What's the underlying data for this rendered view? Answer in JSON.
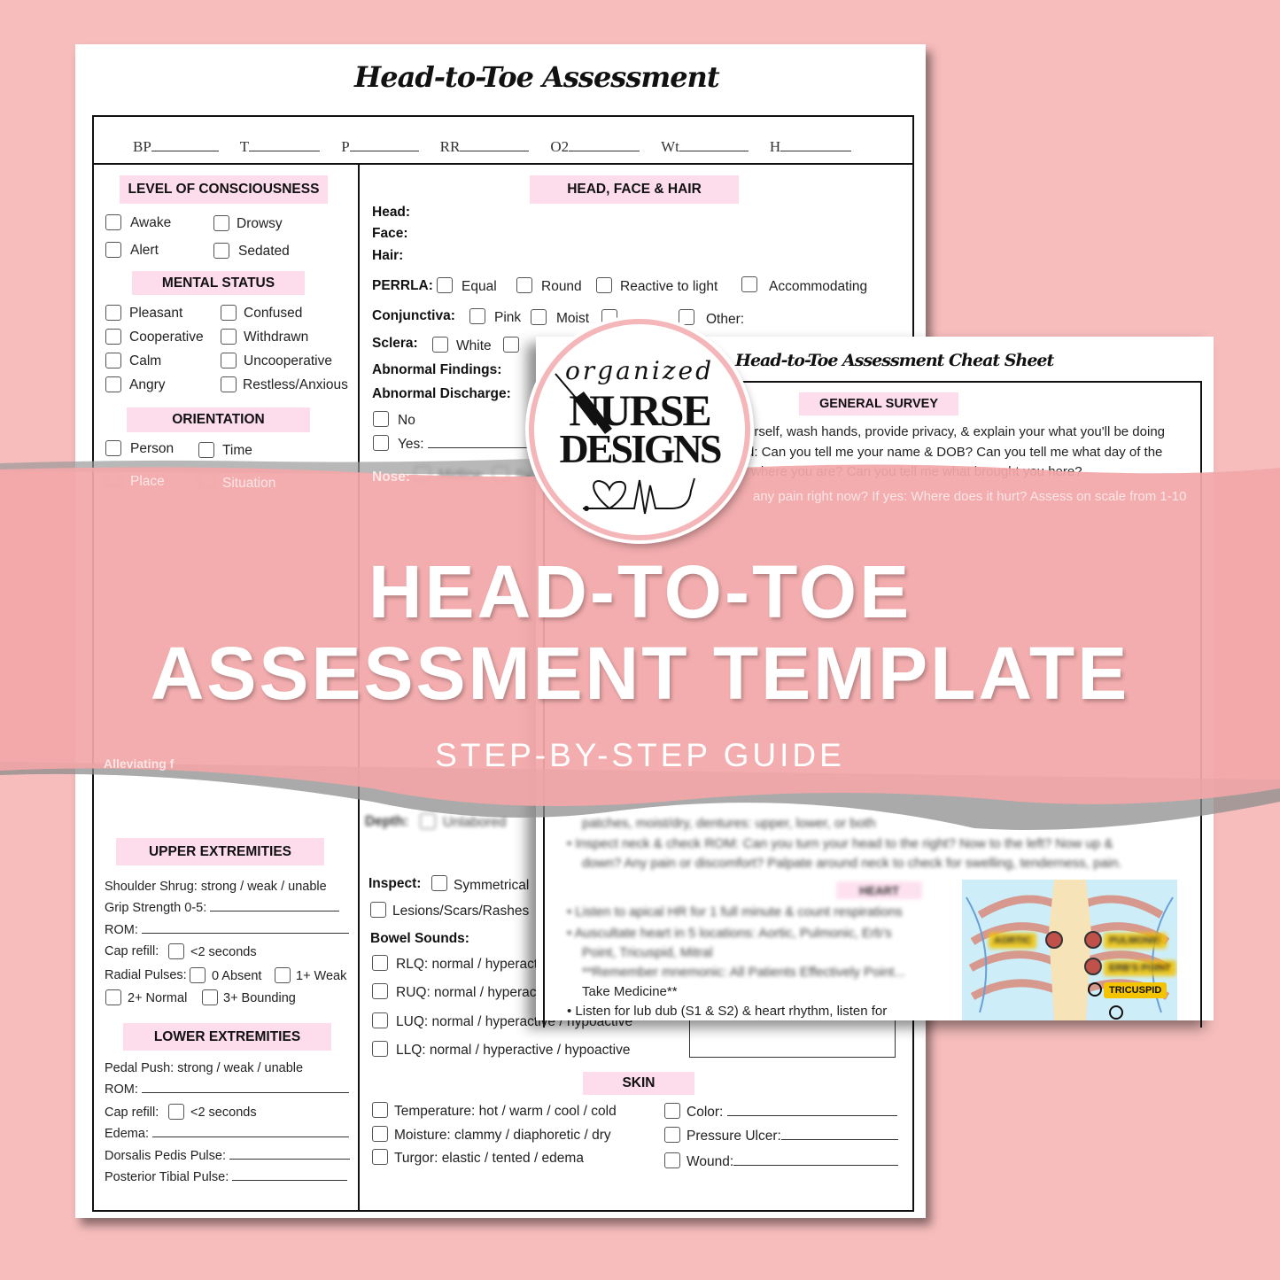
{
  "form": {
    "title": "Head-to-Toe Assessment",
    "vitals": [
      "BP",
      "T",
      "P",
      "RR",
      "O2",
      "Wt",
      "H"
    ],
    "loc": {
      "header": "LEVEL OF CONSCIOUSNESS",
      "options": [
        "Awake",
        "Drowsy",
        "Alert",
        "Sedated"
      ]
    },
    "mental": {
      "header": "MENTAL STATUS",
      "options": [
        "Pleasant",
        "Confused",
        "Cooperative",
        "Withdrawn",
        "Calm",
        "Uncooperative",
        "Angry",
        "Restless/Anxious"
      ]
    },
    "orientation": {
      "header": "ORIENTATION",
      "options": [
        "Person",
        "Time",
        "Place",
        "Situation"
      ]
    },
    "upper": {
      "header": "UPPER EXTREMITIES",
      "shoulder": "Shoulder Shrug: strong / weak / unable",
      "grip": "Grip Strength 0-5:",
      "rom": "ROM:",
      "cap": "Cap refill:",
      "cap_opt": "<2 seconds",
      "radial": "Radial Pulses:",
      "pulses": [
        "0 Absent",
        "1+ Weak",
        "2+ Normal",
        "3+ Bounding"
      ]
    },
    "lower": {
      "header": "LOWER EXTREMITIES",
      "pedal": "Pedal Push: strong / weak / unable",
      "rom": "ROM:",
      "cap": "Cap refill:",
      "cap_opt": "<2 seconds",
      "edema": "Edema:",
      "dorsalis": "Dorsalis Pedis Pulse:",
      "tibial": "Posterior Tibial Pulse:"
    },
    "alleviating": "Alleviating f",
    "hfh": {
      "header": "HEAD, FACE & HAIR",
      "head": "Head:",
      "face": "Face:",
      "hair": "Hair:",
      "perrla": "PERRLA:",
      "perrla_opts": [
        "Equal",
        "Round",
        "Reactive to light",
        "Accommodating"
      ],
      "conj": "Conjunctiva:",
      "conj_opts": [
        "Pink",
        "Moist",
        "Other:"
      ],
      "sclera": "Sclera:",
      "sclera_opts": [
        "White"
      ],
      "findings": "Abnormal Findings:",
      "discharge": "Abnormal Discharge:",
      "no": "No",
      "yes": "Yes:",
      "nose": "Nose:",
      "nose_opts": [
        "Midline",
        "Sy"
      ]
    },
    "depth": "Depth:",
    "depth_opt": "Unlabored",
    "inspect": "Inspect:",
    "inspect_opts": [
      "Symmetrical",
      "Lesions/Scars/Rashes"
    ],
    "bowel": {
      "header": "Bowel Sounds:",
      "items": [
        "RLQ: normal / hyperactive / hypoactive",
        "RUQ: normal / hyperactive / hypoactive",
        "LUQ: normal / hyperactive / hypoactive",
        "LLQ: normal / hyperactive / hypoactive"
      ]
    },
    "skin": {
      "header": "SKIN",
      "left": [
        "Temperature: hot / warm / cool / cold",
        "Moisture: clammy / diaphoretic / dry",
        "Turgor: elastic / tented / edema"
      ],
      "right": [
        "Color:",
        "Pressure Ulcer:",
        "Wound:"
      ]
    }
  },
  "cheat": {
    "title": "Head-to-Toe Assessment Cheat Sheet",
    "general_header": "GENERAL SURVEY",
    "lines": [
      "urself, wash hands, provide privacy, & explain your what you'll be doing",
      "d: Can you tell me your name & DOB? Can you tell me what day of the",
      "where you are?  Can you tell me what brought you here?",
      "any pain right now? If yes: Where does it hurt? Assess on scale from 1-10"
    ],
    "mouth": "patches, moist/dry, dentures: upper, lower, or both",
    "neck1": "Inspect neck & check ROM: Can you turn your head to the right? Now to the left? Now up &",
    "neck2": "down? Any pain or discomfort? Palpate around neck to check for swelling, tenderness, pain.",
    "heart_header": "HEART",
    "heart1": "Listen to apical HR for 1 full minute & count respirations",
    "heart2a": "Auscultate heart in 5 locations: Aortic, Pulmonic, Erb's",
    "heart2b": "Point, Tricuspid, Mitral",
    "mnemonic": "**Remember mnemonic: All Patients Effectively Point...",
    "take": "Take Medicine**",
    "lub": "Listen for lub dub (S1 & S2) & heart rhythm, listen for",
    "labels": [
      "AORTIC",
      "PULMONIC",
      "ERB'S POINT",
      "TRICUSPID"
    ]
  },
  "logo": {
    "top": "organized",
    "line1": "NURSE",
    "line2": "DESIGNS",
    "border_color": "#f4b6b8"
  },
  "banner": {
    "title1": "HEAD-TO-TOE",
    "title2": "ASSESSMENT TEMPLATE",
    "subtitle": "STEP-BY-STEP GUIDE",
    "color": "#f2a7a8"
  },
  "colors": {
    "background": "#f7bdbd",
    "section_header": "#fddcec"
  }
}
